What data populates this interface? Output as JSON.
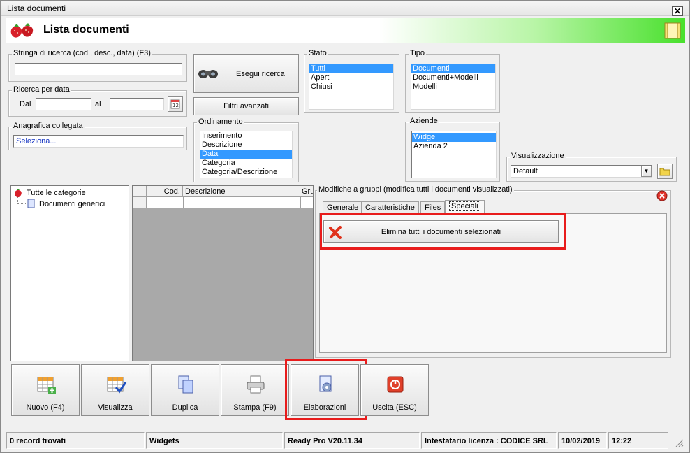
{
  "window": {
    "title": "Lista documenti",
    "close_glyph": "✕"
  },
  "header": {
    "title": "Lista documenti",
    "logo_icon": "strawberry-icon",
    "exit_icon": "book-icon"
  },
  "search": {
    "label": "Stringa di ricerca (cod., desc., data) (F3)",
    "value": ""
  },
  "date_search": {
    "label": "Ricerca per data",
    "from_label": "Dal",
    "to_label": "al",
    "from_value": "",
    "to_value": ""
  },
  "linked_registry": {
    "label": "Anagrafica collegata",
    "value": "Seleziona..."
  },
  "buttons": {
    "search": "Esegui ricerca",
    "advanced": "Filtri avanzati"
  },
  "sort": {
    "label": "Ordinamento",
    "items": [
      "Inserimento",
      "Descrizione",
      "Data",
      "Categoria",
      "Categoria/Descrizione"
    ],
    "selected": "Data"
  },
  "state": {
    "label": "Stato",
    "items": [
      "Tutti",
      "Aperti",
      "Chiusi"
    ],
    "selected": "Tutti"
  },
  "type": {
    "label": "Tipo",
    "items": [
      "Documenti",
      "Documenti+Modelli",
      "Modelli"
    ],
    "selected": "Documenti"
  },
  "companies": {
    "label": "Aziende",
    "items": [
      "Widge",
      "Azienda 2"
    ],
    "selected": "Widge"
  },
  "view": {
    "label": "Visualizzazione",
    "value": "Default"
  },
  "tree": {
    "root": "Tutte le categorie",
    "child": "Documenti generici"
  },
  "grid": {
    "columns": [
      "Cod.",
      "Descrizione",
      "Gru"
    ]
  },
  "group_edit": {
    "label": "Modifiche a gruppi (modifica tutti i documenti visualizzati)",
    "tabs": [
      "Generale",
      "Caratteristiche",
      "Files",
      "Speciali"
    ],
    "active_tab": "Speciali",
    "delete_all": "Elimina tutti i documenti selezionati"
  },
  "toolbar": {
    "new": "Nuovo (F4)",
    "view": "Visualizza",
    "duplicate": "Duplica",
    "print": "Stampa (F9)",
    "processing": "Elaborazioni",
    "exit": "Uscita (ESC)"
  },
  "statusbar": {
    "records": "0 record trovati",
    "module": "Widgets",
    "version": "Ready Pro V20.11.34",
    "license": "Intestatario licenza : CODICE SRL",
    "date": "10/02/2019",
    "time": "12:22"
  },
  "colors": {
    "selection": "#3399ff",
    "highlight": "#e81c1c",
    "header_gradient_end": "#48e02c"
  }
}
